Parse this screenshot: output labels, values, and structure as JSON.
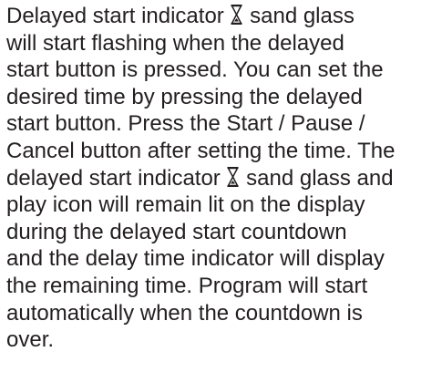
{
  "paragraph": {
    "lines": [
      {
        "before": "Delayed start indicator ",
        "icon": "hourglass-icon",
        "after": " sand glass"
      },
      {
        "text": "will start flashing when the delayed"
      },
      {
        "text": "start button is pressed. You can set the"
      },
      {
        "text": "desired time by pressing the delayed"
      },
      {
        "text": "start button. Press the Start / Pause /"
      },
      {
        "text": "Cancel button after setting the time. The"
      },
      {
        "before": "delayed start indicator ",
        "icon": "hourglass-icon",
        "after": " sand glass and"
      },
      {
        "text": "play icon will remain lit on the display"
      },
      {
        "text": "during the delayed start countdown"
      },
      {
        "text": "and the delay time indicator will display"
      },
      {
        "text": "the remaining time. Program will start"
      },
      {
        "text": "automatically when the countdown is"
      },
      {
        "text": "over."
      }
    ]
  },
  "colors": {
    "text": "#231f20",
    "background": "#ffffff"
  }
}
